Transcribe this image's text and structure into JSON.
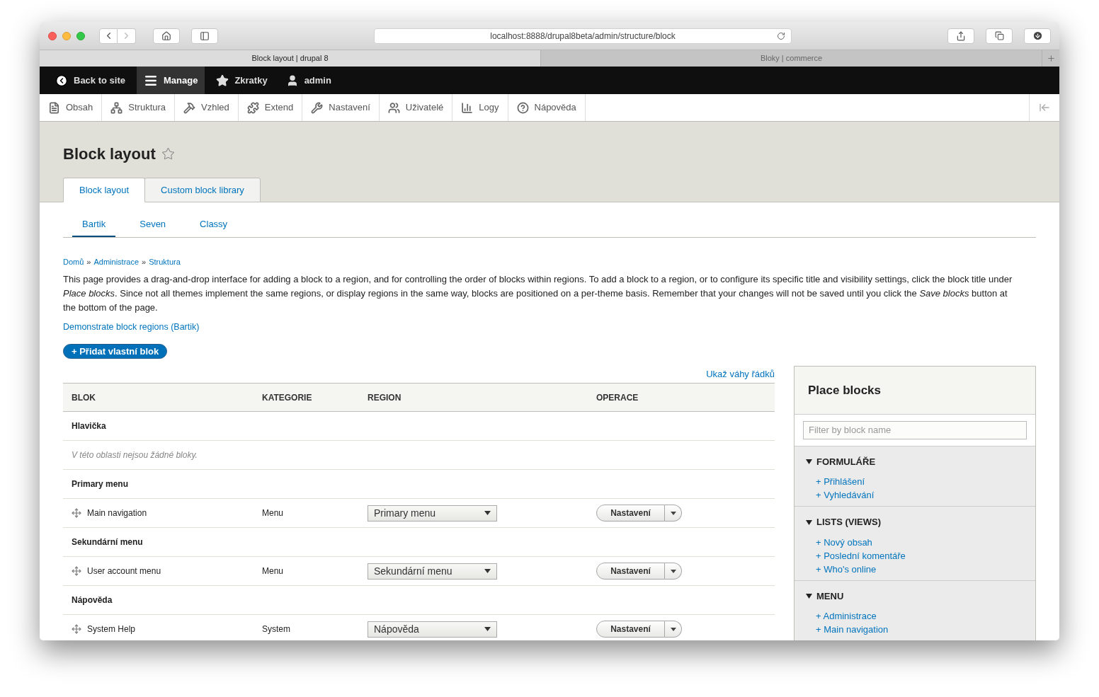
{
  "browser": {
    "url": "localhost:8888/drupal8beta/admin/structure/block",
    "tabs": [
      {
        "title": "Block layout | drupal 8",
        "selected": true
      },
      {
        "title": "Bloky | commerce",
        "selected": false
      }
    ]
  },
  "toolbar": {
    "items": [
      {
        "label": "Back to site",
        "kind": "back",
        "selected": false
      },
      {
        "label": "Manage",
        "kind": "manage",
        "selected": true
      },
      {
        "label": "Zkratky",
        "kind": "shortcuts",
        "selected": false
      },
      {
        "label": "admin",
        "kind": "user",
        "selected": false
      }
    ]
  },
  "tray": {
    "items": [
      {
        "label": "Obsah",
        "kind": "content"
      },
      {
        "label": "Struktura",
        "kind": "structure"
      },
      {
        "label": "Vzhled",
        "kind": "appearance"
      },
      {
        "label": "Extend",
        "kind": "extend"
      },
      {
        "label": "Nastavení",
        "kind": "config"
      },
      {
        "label": "Uživatelé",
        "kind": "people"
      },
      {
        "label": "Logy",
        "kind": "reports"
      },
      {
        "label": "Nápověda",
        "kind": "help"
      }
    ]
  },
  "page": {
    "title": "Block layout",
    "tabs": [
      {
        "label": "Block layout",
        "selected": true
      },
      {
        "label": "Custom block library",
        "selected": false
      }
    ],
    "theme_tabs": [
      {
        "label": "Bartik",
        "selected": true
      },
      {
        "label": "Seven",
        "selected": false
      },
      {
        "label": "Classy",
        "selected": false
      }
    ],
    "breadcrumb": [
      {
        "kind": "link",
        "text": "Domů"
      },
      {
        "kind": "separator",
        "text": "»"
      },
      {
        "kind": "link",
        "text": "Administrace"
      },
      {
        "kind": "separator",
        "text": "»"
      },
      {
        "kind": "link",
        "text": "Struktura"
      }
    ],
    "description": "This page provides a drag-and-drop interface for adding a block to a region, and for controlling the order of blocks within regions. To add a block to a region, or to configure its specific title and visibility settings, click the block title under *Place blocks*. Since not all themes implement the same regions, or display regions in the same way, blocks are positioned on a per-theme basis. Remember that your changes will not be saved until you click the *Save blocks* button at the bottom of the page.",
    "demo_link": "Demonstrate block regions (Bartik)",
    "add_button": "+ Přidat vlastní blok",
    "weights_link": "Ukaž váhy řádků"
  },
  "table": {
    "columns": [
      "BLOK",
      "KATEGORIE",
      "REGION",
      "OPERACE"
    ],
    "rows": [
      {
        "kind": "region",
        "label": "Hlavička"
      },
      {
        "kind": "empty",
        "text": "V této oblasti nejsou žádné bloky."
      },
      {
        "kind": "region",
        "label": "Primary menu"
      },
      {
        "kind": "block",
        "name": "Main navigation",
        "category": "Menu",
        "region": "Primary menu",
        "operation": "Nastavení"
      },
      {
        "kind": "region",
        "label": "Sekundární menu"
      },
      {
        "kind": "block",
        "name": "User account menu",
        "category": "Menu",
        "region": "Sekundární menu",
        "operation": "Nastavení"
      },
      {
        "kind": "region",
        "label": "Nápověda"
      },
      {
        "kind": "block",
        "name": "System Help",
        "category": "System",
        "region": "Nápověda",
        "operation": "Nastavení"
      }
    ]
  },
  "place_blocks": {
    "title": "Place blocks",
    "filter": {
      "placeholder": "Filter by block name"
    },
    "categories": [
      {
        "name": "FORMULÁŘE",
        "expanded": true,
        "items": [
          "+ Přihlášení",
          "+ Vyhledávání"
        ]
      },
      {
        "name": "LISTS (VIEWS)",
        "expanded": true,
        "items": [
          "+ Nový obsah",
          "+ Poslední komentáře",
          "+ Who's online"
        ]
      },
      {
        "name": "MENU",
        "expanded": true,
        "items": [
          "+ Administrace",
          "+ Main navigation"
        ]
      }
    ]
  }
}
